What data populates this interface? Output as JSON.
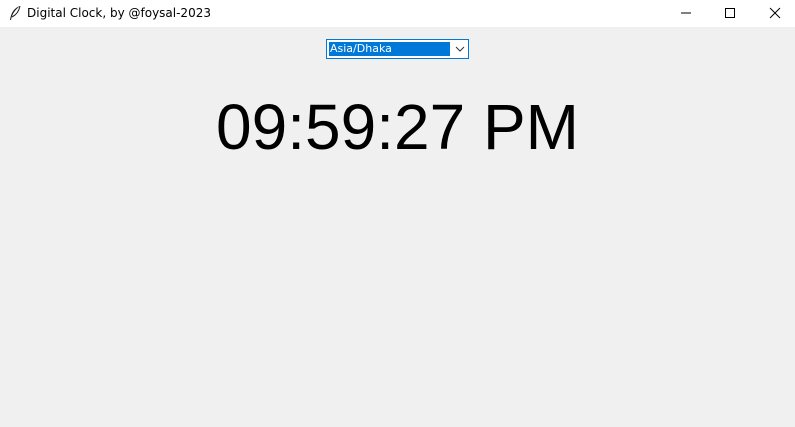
{
  "window": {
    "title": "Digital Clock, by @foysal-2023",
    "icon": "feather-icon",
    "controls": [
      "minimize-icon",
      "maximize-icon",
      "close-icon"
    ]
  },
  "timezone_select": {
    "value": "Asia/Dhaka",
    "arrow_icon": "chevron-down-icon"
  },
  "clock": {
    "time": "09:59:27 PM"
  },
  "colors": {
    "background": "#f0f0f0",
    "titlebar": "#ffffff",
    "selection": "#0078d7",
    "text": "#000000"
  }
}
